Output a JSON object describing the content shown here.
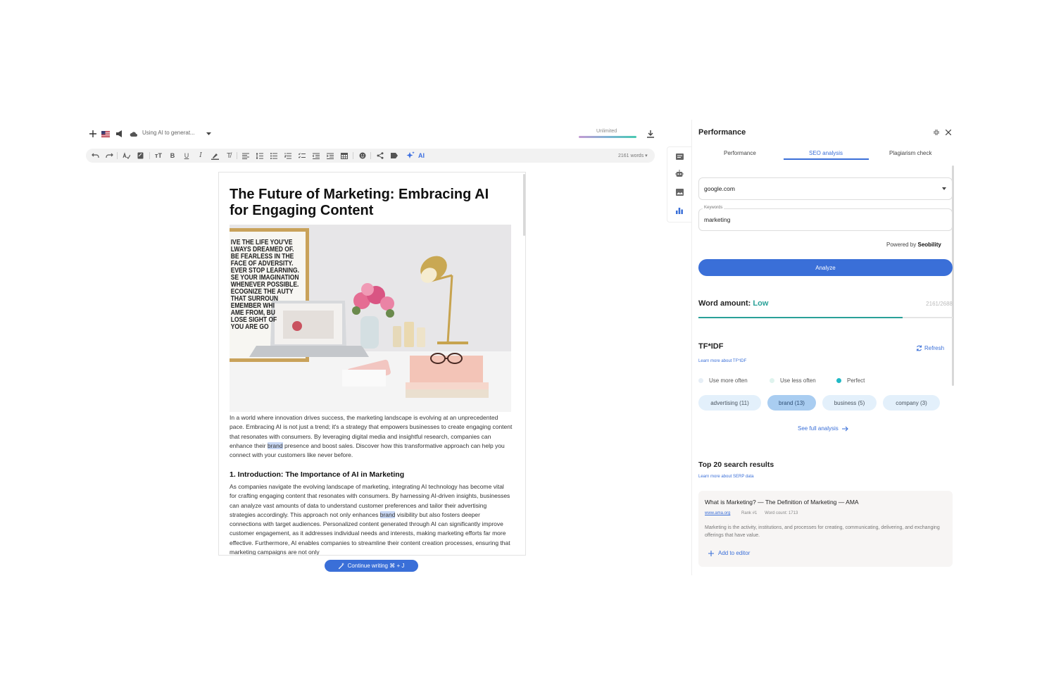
{
  "topbar": {
    "status_text": "Using AI to generat...",
    "usage_label": "Unlimited"
  },
  "toolbar": {
    "ai_label": "AI",
    "word_count": "2161 words ▾"
  },
  "document": {
    "title": "The Future of Marketing: Embracing AI for Engaging Content",
    "image_poster_lines": [
      "IVE THE LIFE YOU'VE",
      "LWAYS DREAMED OF.",
      "BE FEARLESS IN THE",
      "FACE OF ADVERSITY.",
      "EVER STOP LEARNING.",
      "SE YOUR IMAGINATION",
      "WHENEVER POSSIBLE.",
      "ECOGNIZE THE   AUTY",
      "THAT SURROUN",
      "EMEMBER WHI",
      "AME FROM, BU",
      "LOSE SIGHT OF",
      "YOU ARE GO"
    ],
    "p1_a": "In a world where innovation drives success, the marketing landscape is evolving at an unprecedented pace. Embracing AI is not just a trend; it's a strategy that empowers businesses to create engaging content that resonates with consumers. By leveraging digital media and insightful research, companies can enhance their ",
    "p1_hl": "brand",
    "p1_b": " presence and boost sales. Discover how this transformative approach can help you connect with your customers like never before.",
    "h2": "1. Introduction: The Importance of AI in Marketing",
    "p2_a": "As companies navigate the evolving landscape of marketing, integrating AI technology has become vital for crafting engaging content that resonates with consumers. By harnessing AI-driven insights, businesses can analyze vast amounts of data to understand customer preferences and tailor their advertising strategies accordingly. This approach not only enhances ",
    "p2_hl": "brand",
    "p2_b": " visibility but also fosters deeper connections with target audiences. Personalized content generated through AI can significantly improve customer engagement, as it addresses individual needs and interests, making marketing efforts far more effective. Furthermore, AI enables companies to streamline their content creation processes, ensuring that marketing campaigns are not only"
  },
  "continue_button": "Continue writing ⌘ + J",
  "panel": {
    "title": "Performance",
    "tabs": [
      "Performance",
      "SEO analysis",
      "Plagiarism check"
    ],
    "active_tab": "SEO analysis",
    "domain_value": "google.com",
    "keywords_label": "Keywords",
    "keywords_value": "marketing",
    "powered_prefix": "Powered by",
    "powered_brand": "Seobility",
    "analyze_label": "Analyze",
    "word_amount_label": "Word amount:",
    "word_amount_level": "Low",
    "word_amount_ratio": "2161/2688",
    "word_amount_fraction": 0.804,
    "tfidf_title": "TF*IDF",
    "refresh_label": "Refresh",
    "tfidf_learn": "Learn more about TF*IDF",
    "legend": [
      {
        "label": "Use more often",
        "color": "#e6eef6"
      },
      {
        "label": "Use less often",
        "color": "#dff3ee"
      },
      {
        "label": "Perfect",
        "color": "#21b9c6"
      }
    ],
    "chips": [
      {
        "label": "advertising (11)",
        "active": false
      },
      {
        "label": "brand (13)",
        "active": true
      },
      {
        "label": "business (5)",
        "active": false
      },
      {
        "label": "company (3)",
        "active": false
      }
    ],
    "see_full": "See full analysis",
    "top20_title": "Top 20 search results",
    "serp_learn": "Learn more about SERP data",
    "result": {
      "title": "What is Marketing? — The Definition of Marketing — AMA",
      "url": "www.ama.org",
      "rank": "Rank #1",
      "word_count": "Word count: 1713",
      "description": "Marketing is the activity, institutions, and processes for creating, communicating, delivering, and exchanging offerings that have value.",
      "add_label": "Add to editor"
    }
  },
  "colors": {
    "accent": "#3a6fd8",
    "teal": "#2aa198",
    "chip_bg": "#e3f0fb",
    "chip_active": "#a9cdf1"
  }
}
